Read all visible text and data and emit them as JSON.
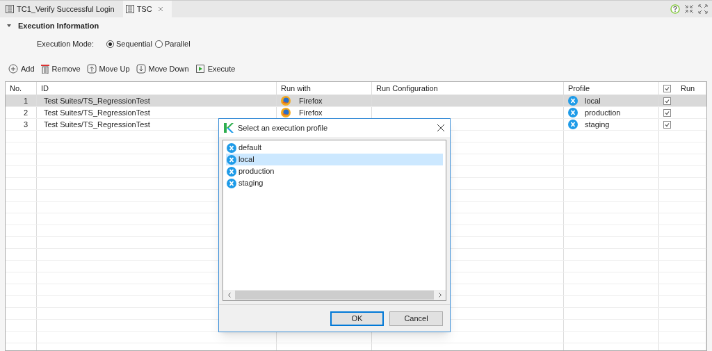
{
  "tabs": [
    {
      "label": "TC1_Verify Successful Login",
      "selected": false,
      "closable": false
    },
    {
      "label": "TSC",
      "selected": true,
      "closable": true
    }
  ],
  "section": {
    "title": "Execution Information",
    "expanded": true
  },
  "execution_mode": {
    "label": "Execution Mode:",
    "options": [
      {
        "label": "Sequential",
        "selected": true
      },
      {
        "label": "Parallel",
        "selected": false
      }
    ]
  },
  "toolbar": [
    {
      "label": "Add",
      "kind": "add"
    },
    {
      "label": "Remove",
      "kind": "remove"
    },
    {
      "label": "Move Up",
      "kind": "up"
    },
    {
      "label": "Move Down",
      "kind": "down"
    },
    {
      "label": "Execute",
      "kind": "execute"
    }
  ],
  "table": {
    "columns": [
      "No.",
      "ID",
      "Run with",
      "Run Configuration",
      "Profile",
      "Run"
    ],
    "run_all_checked": true,
    "rows": [
      {
        "no": "1",
        "id": "Test Suites/TS_RegressionTest",
        "run_with": "Firefox",
        "profile": "local",
        "run": true,
        "selected": true
      },
      {
        "no": "2",
        "id": "Test Suites/TS_RegressionTest",
        "run_with": "Firefox",
        "profile": "production",
        "run": true,
        "selected": false
      },
      {
        "no": "3",
        "id": "Test Suites/TS_RegressionTest",
        "profile": "staging",
        "run": true,
        "selected": false
      }
    ]
  },
  "dialog": {
    "title": "Select an execution profile",
    "items": [
      {
        "label": "default",
        "selected": false
      },
      {
        "label": "local",
        "selected": true
      },
      {
        "label": "production",
        "selected": false
      },
      {
        "label": "staging",
        "selected": false
      }
    ],
    "buttons": [
      {
        "label": "OK",
        "kind": "default"
      },
      {
        "label": "Cancel",
        "kind": "normal"
      }
    ]
  }
}
